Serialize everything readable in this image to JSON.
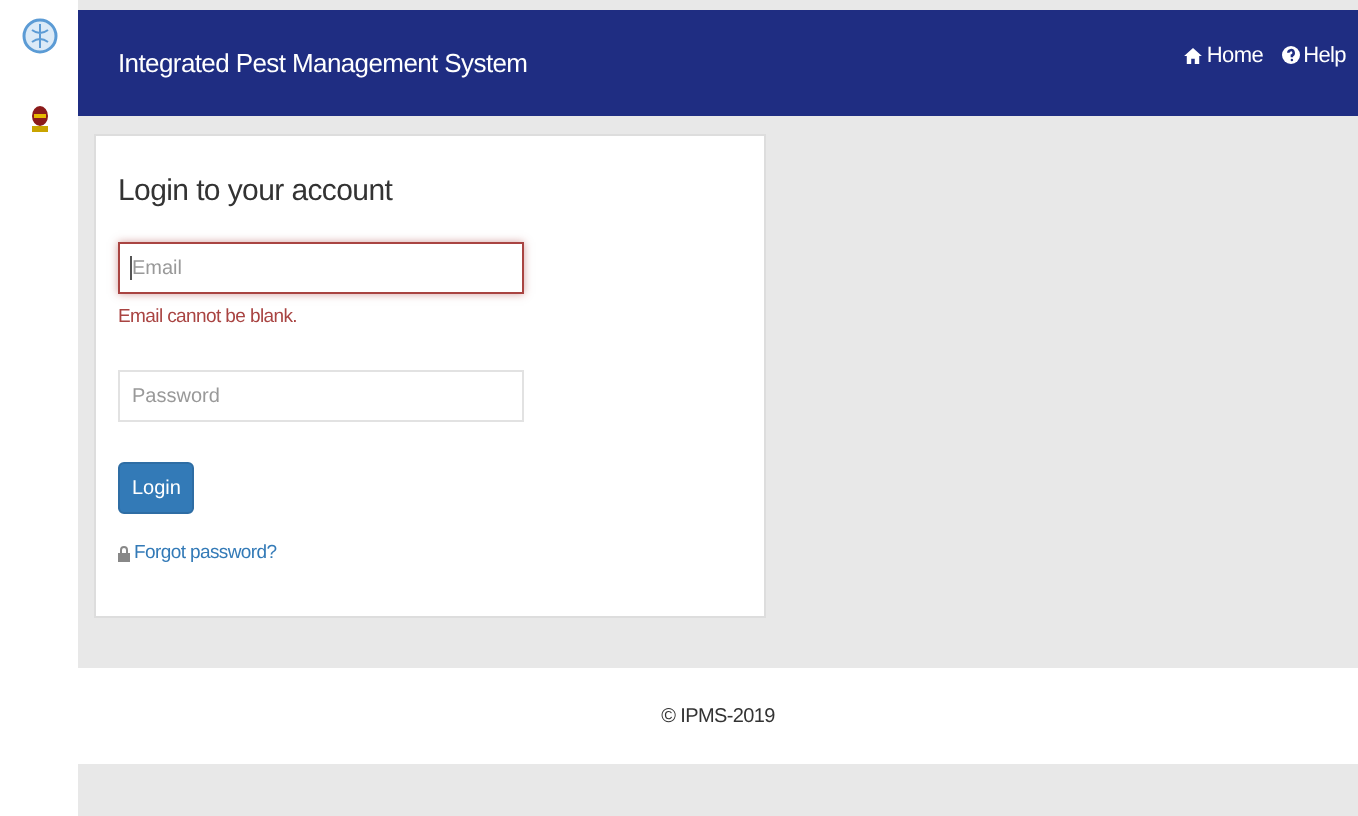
{
  "header": {
    "title": "Integrated Pest Management System",
    "links": [
      {
        "label": "Home",
        "kind": "home"
      },
      {
        "label": "Help",
        "kind": "help"
      }
    ]
  },
  "login": {
    "title": "Login to your account",
    "fields": [
      {
        "placeholder": "Email",
        "invalid": true,
        "focused": true,
        "error": "Email cannot be blank."
      },
      {
        "placeholder": "Password",
        "invalid": false,
        "focused": false
      }
    ],
    "button": "Login",
    "forgot": "Forgot password?"
  },
  "footer": "© IPMS-2019"
}
